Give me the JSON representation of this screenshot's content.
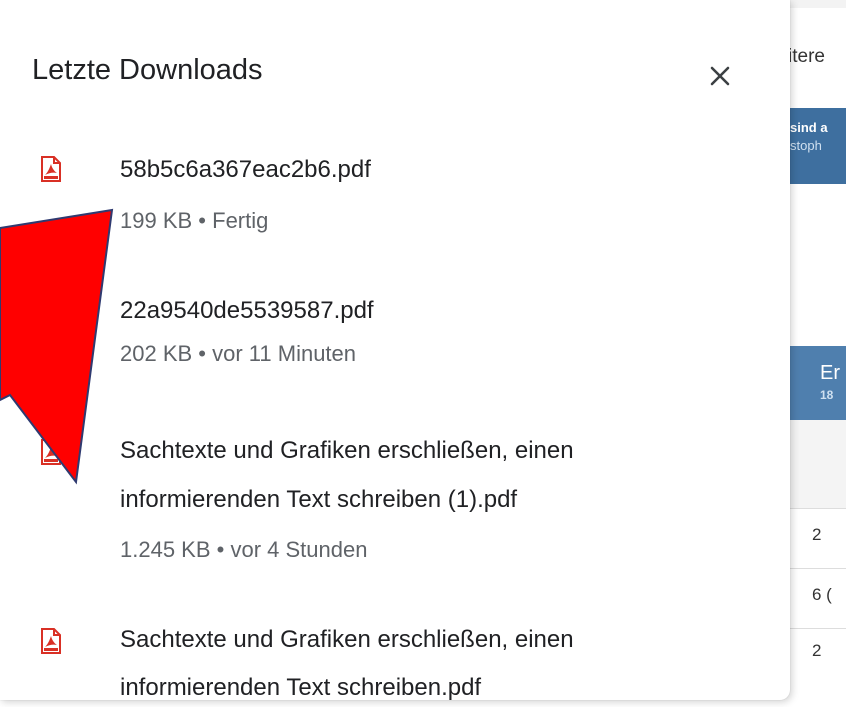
{
  "panel": {
    "title": "Letzte Downloads",
    "close_icon": "close-icon"
  },
  "downloads": [
    {
      "name_line1": "58b5c6a367eac2b6.pdf",
      "name_line2": "",
      "size": "199 KB",
      "status": "Fertig",
      "icon": "pdf-file-icon"
    },
    {
      "name_line1": "22a9540de5539587.pdf",
      "name_line2": "",
      "size": "202 KB",
      "status": "vor 11 Minuten",
      "icon": "pdf-file-icon"
    },
    {
      "name_line1": "Sachtexte und Grafiken erschließen, einen",
      "name_line2": "informierenden Text schreiben (1).pdf",
      "size": "1.245 KB",
      "status": "vor 4 Stunden",
      "icon": "pdf-file-icon"
    },
    {
      "name_line1": "Sachtexte und Grafiken erschließen, einen",
      "name_line2": "informierenden Text schreiben.pdf",
      "size": "",
      "status": "",
      "icon": "pdf-file-icon"
    }
  ],
  "separator": "•",
  "background_page": {
    "top_text": "itere",
    "bar_line1": "sind a",
    "bar_line2": "stoph",
    "column_header": "Er",
    "column_sub": "18",
    "rows": [
      "2",
      "6 (",
      "2"
    ]
  },
  "colors": {
    "pdf_red": "#d93025",
    "arrow_red": "#ff0000",
    "arrow_outline": "#2f3a70",
    "header_blue": "#4f7fae"
  }
}
